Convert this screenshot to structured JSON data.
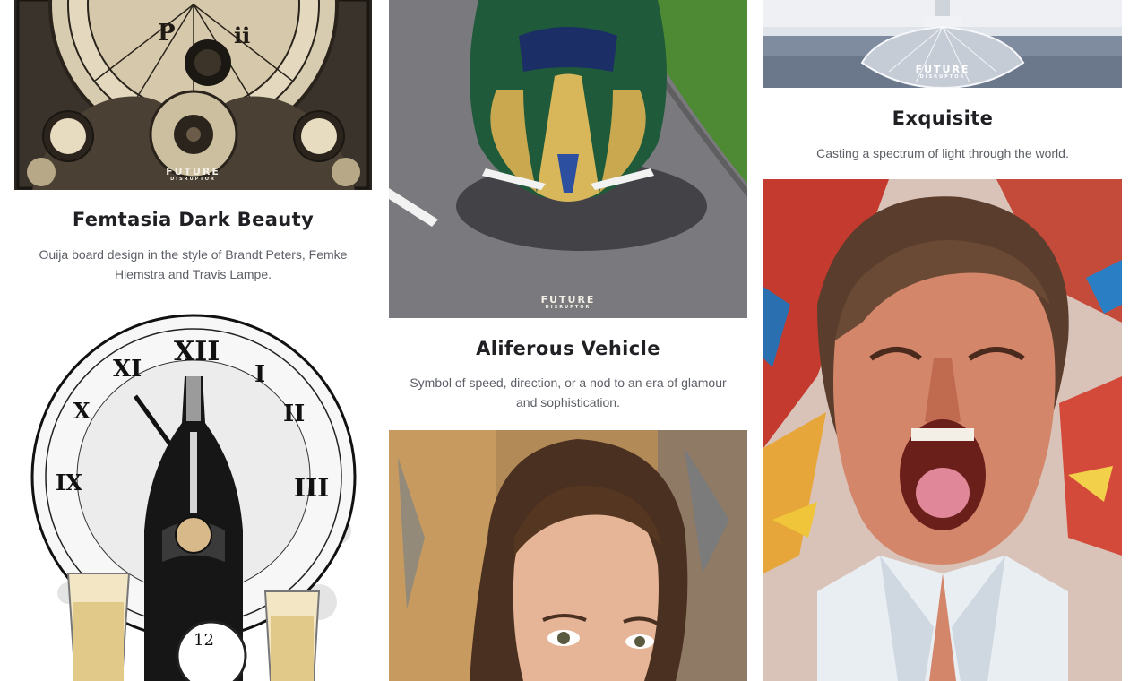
{
  "watermark": {
    "line1": "FUTURE",
    "line2": "DISRUPTOR"
  },
  "cards": [
    {
      "title": "Femtasia Dark Beauty",
      "description": "Ouija board design in the style of Brandt Peters, Femke Hiemstra and Travis Lampe.",
      "image_icon": "ouija-board-artwork"
    },
    {
      "title": "Aliferous Vehicle",
      "description": "Symbol of speed, direction, or a nod to an era of glamour and sophistication.",
      "image_icon": "vintage-sports-car-artwork"
    },
    {
      "title": "Exquisite",
      "description": "Casting a spectrum of light through the world.",
      "image_icon": "crystal-glass-artwork"
    },
    {
      "title": "",
      "description": "",
      "image_icon": "champagne-clock-artwork"
    },
    {
      "title": "",
      "description": "",
      "image_icon": "woman-portrait-artwork"
    },
    {
      "title": "",
      "description": "",
      "image_icon": "screaming-man-artwork"
    }
  ],
  "clock_numerals": [
    "XII",
    "XI",
    "I",
    "X",
    "II",
    "IX",
    "III"
  ]
}
